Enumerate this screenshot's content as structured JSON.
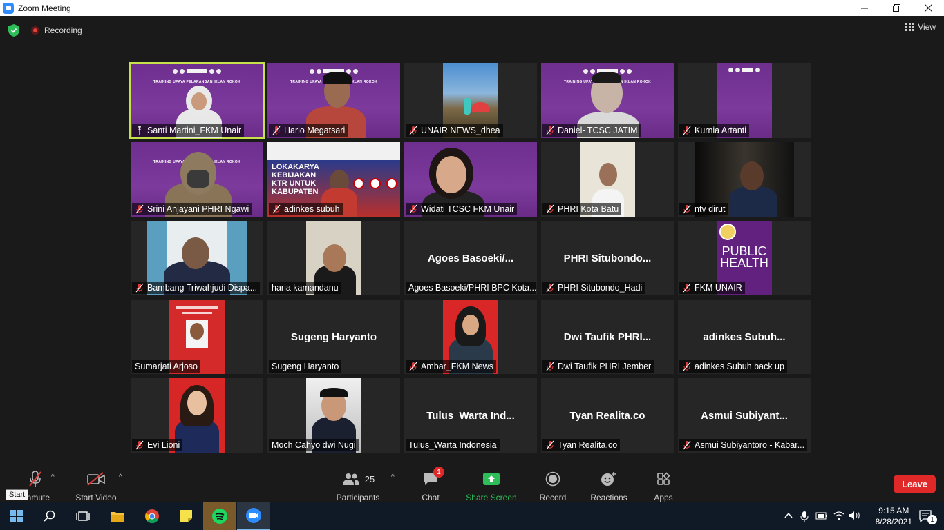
{
  "window": {
    "title": "Zoom Meeting"
  },
  "topbar": {
    "recording_label": "Recording",
    "view_label": "View"
  },
  "participants": [
    {
      "name": "Santi Martini_FKM Unair",
      "muted": false,
      "pinned": true,
      "video": true
    },
    {
      "name": "Hario Megatsari",
      "muted": true,
      "video": true
    },
    {
      "name": "UNAIR NEWS_dhea",
      "muted": true,
      "video": true
    },
    {
      "name": "Daniel- TCSC JATIM",
      "muted": true,
      "video": true
    },
    {
      "name": "Kurnia Artanti",
      "muted": true,
      "video": true
    },
    {
      "name": "Srini Anjayani PHRI Ngawi",
      "muted": true,
      "video": true
    },
    {
      "name": "adinkes subuh",
      "muted": true,
      "video": true
    },
    {
      "name": "Widati TCSC FKM Unair",
      "muted": true,
      "video": true
    },
    {
      "name": "PHRI Kota Batu",
      "muted": true,
      "video": true
    },
    {
      "name": "ntv dirut",
      "muted": true,
      "video": true
    },
    {
      "name": "Bambang Triwahjudi Dispa...",
      "muted": true,
      "video": true
    },
    {
      "name": "haria kamandanu",
      "muted": false,
      "video": true
    },
    {
      "name": "Agoes Basoeki/PHRI BPC Kota...",
      "display": "Agoes  Basoeki/...",
      "muted": false,
      "video": false
    },
    {
      "name": "PHRI Situbondo_Hadi",
      "display": "PHRI  Situbondo...",
      "muted": true,
      "video": false
    },
    {
      "name": "FKM UNAIR",
      "muted": true,
      "video": true,
      "logo_text": [
        "PUBLIC",
        "HEALTH"
      ]
    },
    {
      "name": "Sumarjati Arjoso",
      "muted": false,
      "video": true
    },
    {
      "name": "Sugeng Haryanto",
      "display": "Sugeng Haryanto",
      "muted": false,
      "video": false
    },
    {
      "name": "Ambar_FKM News",
      "muted": true,
      "video": true
    },
    {
      "name": "Dwi Taufik PHRI Jember",
      "display": "Dwi  Taufik PHRI...",
      "muted": true,
      "video": false
    },
    {
      "name": "adinkes Subuh back up",
      "display": "adinkes  Subuh...",
      "muted": true,
      "video": false
    },
    {
      "name": "Evi Lioni",
      "muted": true,
      "video": true
    },
    {
      "name": "Moch Cahyo dwi Nugi",
      "muted": false,
      "video": true
    },
    {
      "name": "Tulus_Warta Indonesia",
      "display": "Tulus_Warta  Ind...",
      "muted": false,
      "video": false
    },
    {
      "name": "Tyan Realita.co",
      "display": "Tyan Realita.co",
      "muted": true,
      "video": false
    },
    {
      "name": "Asmui Subiyantoro - Kabar...",
      "display": "Asmui  Subiyant...",
      "muted": true,
      "video": false
    }
  ],
  "toolbar": {
    "unmute_label": "Unmute",
    "start_video_label": "Start Video",
    "participants_label": "Participants",
    "participants_count": "25",
    "chat_label": "Chat",
    "chat_badge": "1",
    "share_label": "Share Screen",
    "record_label": "Record",
    "reactions_label": "Reactions",
    "apps_label": "Apps",
    "leave_label": "Leave",
    "tooltip": "Start"
  },
  "taskbar": {
    "time": "9:15 AM",
    "date": "8/28/2021",
    "notif_count": "1"
  },
  "colors": {
    "accent_green": "#2ebd59",
    "leave_red": "#e02828",
    "active_speaker": "#c6e14a",
    "purple_bg": "#7c3a9c"
  }
}
